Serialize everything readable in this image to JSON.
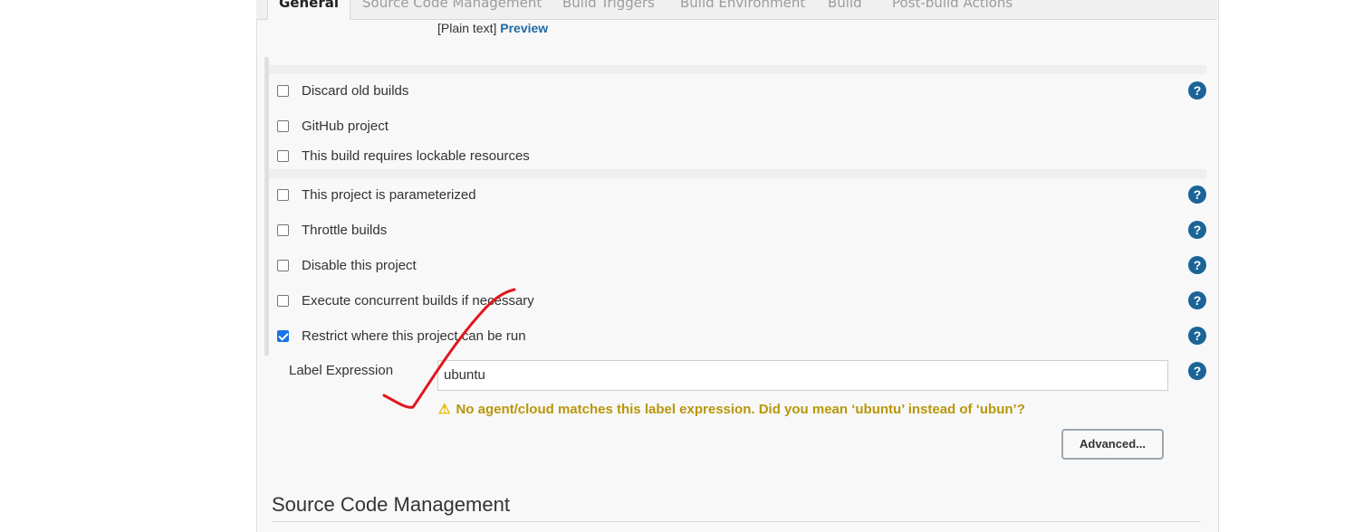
{
  "tabs": [
    {
      "label": "General",
      "active": true
    },
    {
      "label": "Source Code Management"
    },
    {
      "label": "Build Triggers"
    },
    {
      "label": "Build Environment"
    },
    {
      "label": "Build"
    },
    {
      "label": "Post-build Actions"
    }
  ],
  "description_format": {
    "plain_text": "[Plain text]",
    "preview_link": "Preview"
  },
  "options": [
    {
      "label": "Discard old builds",
      "checked": false
    },
    {
      "label": "GitHub project",
      "checked": false
    },
    {
      "label": "This build requires lockable resources",
      "checked": false
    },
    {
      "label": "This project is parameterized",
      "checked": false
    },
    {
      "label": "Throttle builds",
      "checked": false
    },
    {
      "label": "Disable this project",
      "checked": false
    },
    {
      "label": "Execute concurrent builds if necessary",
      "checked": false
    },
    {
      "label": "Restrict where this project can be run",
      "checked": true
    }
  ],
  "label_expression": {
    "label": "Label Expression",
    "value": "ubuntu",
    "warning": "No agent/cloud matches this label expression. Did you mean ‘ubuntu’ instead of ‘ubun’?"
  },
  "advanced_button": "Advanced...",
  "section_scm": {
    "title": "Source Code Management"
  },
  "icons": {
    "help": "help-icon",
    "warning": "warning-icon",
    "check": "checkmark-annotation"
  },
  "colors": {
    "help": "#1a6496",
    "warning": "#b8960a",
    "annotation": "#e0161c",
    "link": "#1f6aa5"
  }
}
